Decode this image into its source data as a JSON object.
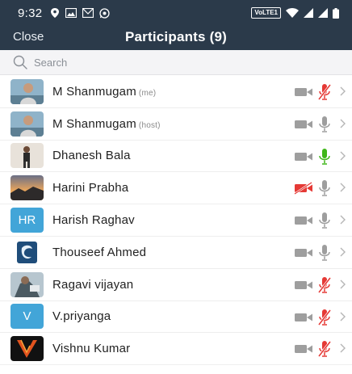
{
  "status_bar": {
    "time": "9:32",
    "network_badge": "VoLTE1"
  },
  "nav": {
    "close_label": "Close",
    "title": "Participants (9)"
  },
  "search": {
    "placeholder": "Search"
  },
  "colors": {
    "header_bg": "#2b3a4a",
    "muted_red": "#e53935",
    "speaking_green": "#3fb618",
    "icon_gray": "#9e9e9e"
  },
  "participants": [
    {
      "name": "M Shanmugam",
      "role": "(me)",
      "video": "on",
      "audio": "muted",
      "avatar": "photo-man-1"
    },
    {
      "name": "M Shanmugam",
      "role": "(host)",
      "video": "on",
      "audio": "on",
      "avatar": "photo-man-1"
    },
    {
      "name": "Dhanesh Bala",
      "role": "",
      "video": "on",
      "audio": "speaking",
      "avatar": "photo-man-2"
    },
    {
      "name": "Harini Prabha",
      "role": "",
      "video": "off",
      "audio": "on",
      "avatar": "photo-sunset"
    },
    {
      "name": "Harish Raghav",
      "role": "",
      "video": "on",
      "audio": "on",
      "avatar": "initials",
      "initials": "HR"
    },
    {
      "name": "Thouseef Ahmed",
      "role": "",
      "video": "on",
      "audio": "on",
      "avatar": "photo-logo"
    },
    {
      "name": "Ragavi vijayan",
      "role": "",
      "video": "on",
      "audio": "muted",
      "avatar": "photo-person"
    },
    {
      "name": "V.priyanga",
      "role": "",
      "video": "on",
      "audio": "muted",
      "avatar": "initials",
      "initials": "V"
    },
    {
      "name": "Vishnu Kumar",
      "role": "",
      "video": "on",
      "audio": "muted",
      "avatar": "photo-v-logo"
    }
  ]
}
